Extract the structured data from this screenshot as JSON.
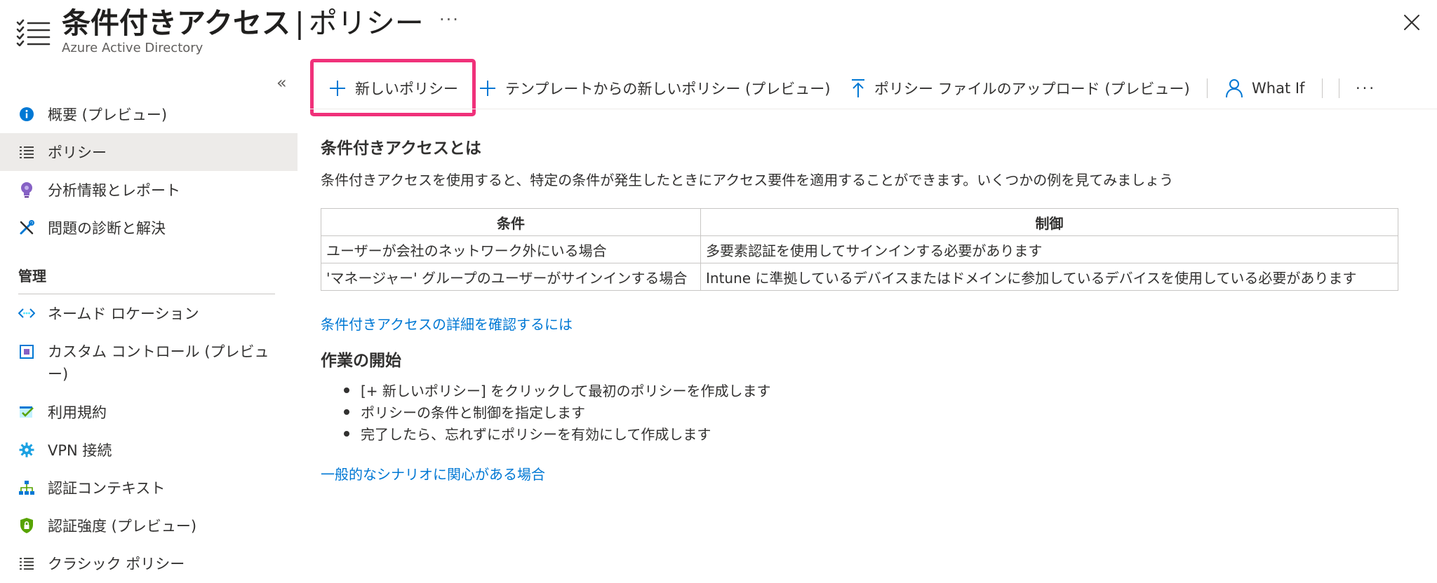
{
  "header": {
    "title_main": "条件付きアクセス",
    "title_separator": "|",
    "title_sub": "ポリシー",
    "subtitle": "Azure Active Directory",
    "more_label": "···",
    "icons": {
      "blade": "list-icon",
      "close": "close-icon",
      "more": "more-icon"
    }
  },
  "sidebar": {
    "collapse_label": "«",
    "items": [
      {
        "label": "概要 (プレビュー)",
        "icon": "info-icon",
        "selected": false
      },
      {
        "label": "ポリシー",
        "icon": "list-icon",
        "selected": true
      },
      {
        "label": "分析情報とレポート",
        "icon": "lightbulb-icon",
        "selected": false
      },
      {
        "label": "問題の診断と解決",
        "icon": "wrench-icon",
        "selected": false
      }
    ],
    "section_label": "管理",
    "manage_items": [
      {
        "label": "ネームド ロケーション",
        "icon": "location-icon"
      },
      {
        "label": "カスタム コントロール (プレビュー)",
        "icon": "custom-control-icon"
      },
      {
        "label": "利用規約",
        "icon": "checklist-icon"
      },
      {
        "label": "VPN 接続",
        "icon": "gear-icon"
      },
      {
        "label": "認証コンテキスト",
        "icon": "hierarchy-icon"
      },
      {
        "label": "認証強度 (プレビュー)",
        "icon": "shield-lock-icon"
      },
      {
        "label": "クラシック ポリシー",
        "icon": "list-icon"
      }
    ]
  },
  "toolbar": {
    "new_policy": "新しいポリシー",
    "new_from_template": "テンプレートからの新しいポリシー (プレビュー)",
    "upload_policy": "ポリシー ファイルのアップロード (プレビュー)",
    "what_if": "What If",
    "more": "···",
    "highlight_color": "#f0317a"
  },
  "main": {
    "heading": "条件付きアクセスとは",
    "description": "条件付きアクセスを使用すると、特定の条件が発生したときにアクセス要件を適用することができます。いくつかの例を見てみましょう",
    "table": {
      "headers": [
        "条件",
        "制御"
      ],
      "rows": [
        [
          "ユーザーが会社のネットワーク外にいる場合",
          "多要素認証を使用してサインインする必要があります"
        ],
        [
          "'マネージャー' グループのユーザーがサインインする場合",
          "Intune に準拠しているデバイスまたはドメインに参加しているデバイスを使用している必要があります"
        ]
      ]
    },
    "learn_more_link": "条件付きアクセスの詳細を確認するには",
    "getting_started_heading": "作業の開始",
    "steps": [
      "[+ 新しいポリシー] をクリックして最初のポリシーを作成します",
      "ポリシーの条件と制御を指定します",
      "完了したら、忘れずにポリシーを有効にして作成します"
    ],
    "scenarios_link": "一般的なシナリオに関心がある場合"
  },
  "colors": {
    "link": "#0078d4",
    "selected_bg": "#edebe9",
    "text": "#323130"
  }
}
